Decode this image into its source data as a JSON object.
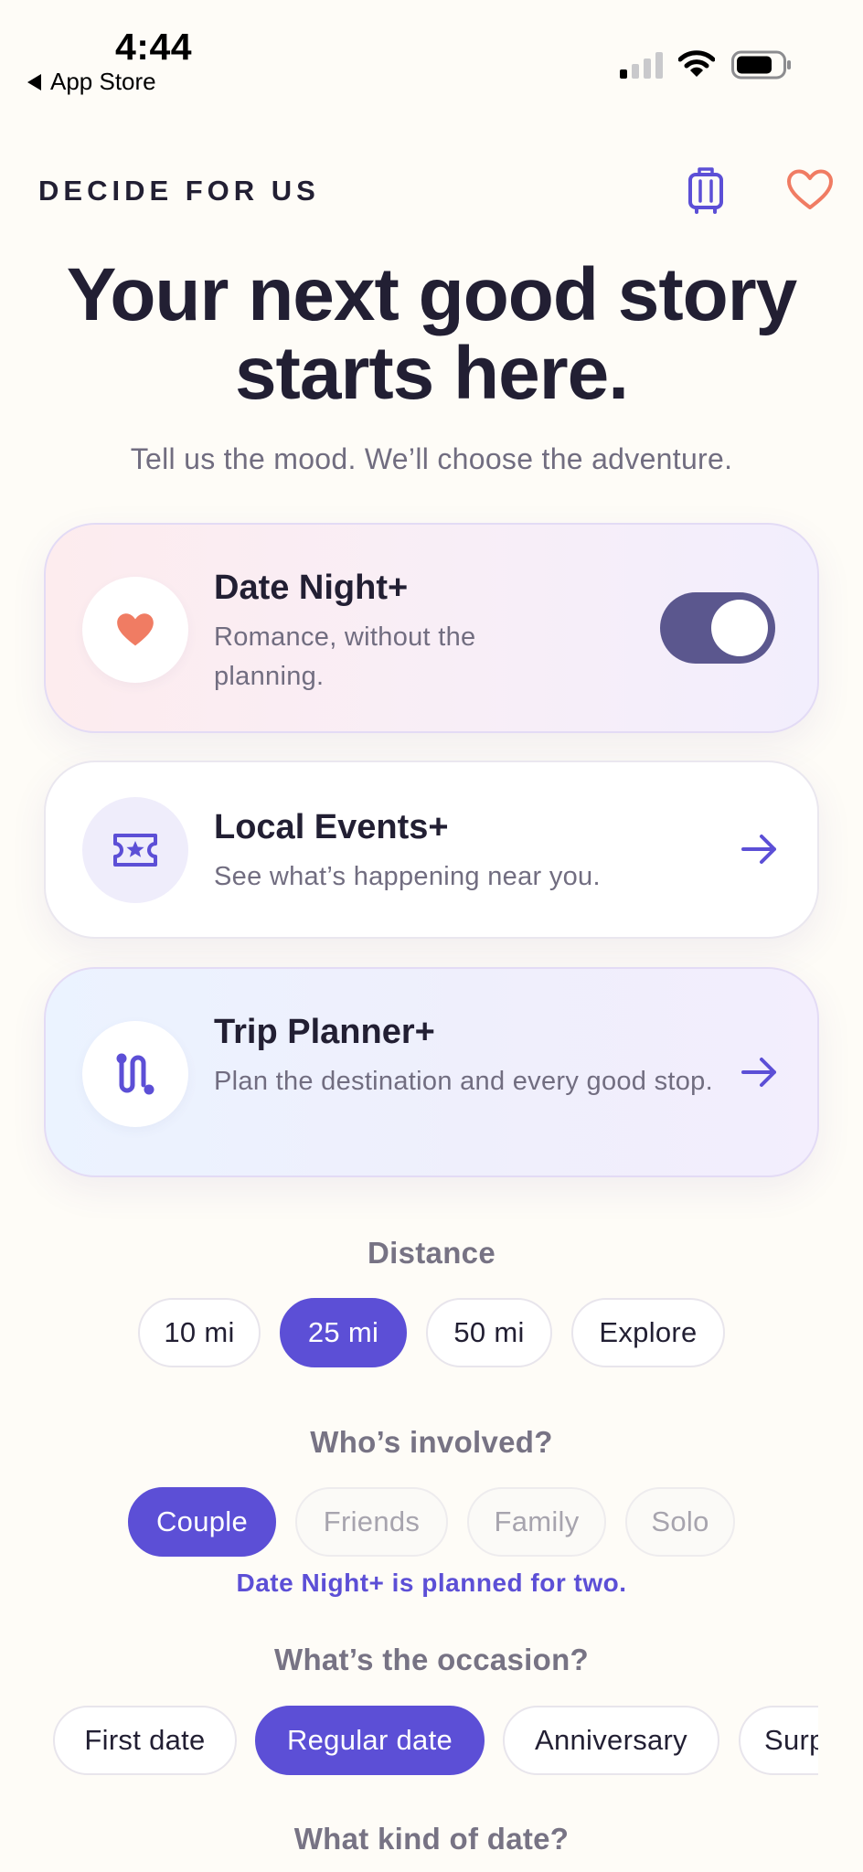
{
  "status_bar": {
    "time": "4:44",
    "back_label": "App Store",
    "icons": [
      "signal-icon",
      "wifi-icon",
      "battery-icon"
    ]
  },
  "header": {
    "brand": "DECIDE FOR US",
    "icons": [
      "luggage-icon",
      "heart-outline-icon"
    ]
  },
  "hero": {
    "title_line1": "Your next good story",
    "title_line2": "starts here.",
    "subtitle": "Tell us the mood. We’ll choose the adventure."
  },
  "modes": [
    {
      "title": "Date Night+",
      "description": "Romance, without the planning.",
      "icon": "heart-icon",
      "enabled": true
    },
    {
      "title": "Local Events+",
      "description": "See what’s happening near you.",
      "icon": "ticket-icon"
    },
    {
      "title": "Trip Planner+",
      "description": "Plan the destination and every good stop.",
      "icon": "route-icon"
    }
  ],
  "distance": {
    "title": "Distance",
    "options": [
      "10 mi",
      "25 mi",
      "50 mi",
      "Explore"
    ],
    "selected": "25 mi"
  },
  "who": {
    "title": "Who’s involved?",
    "options": [
      "Couple",
      "Friends",
      "Family",
      "Solo"
    ],
    "selected": "Couple",
    "note": "Date Night+ is planned for two."
  },
  "occasion": {
    "title": "What’s the occasion?",
    "options": [
      "First date",
      "Regular date",
      "Anniversary",
      "Surprise"
    ],
    "selected": "Regular date"
  },
  "date_kind": {
    "title": "What kind of date?"
  },
  "colors": {
    "accent": "#5C4FD6",
    "coral": "#F07C63",
    "background": "#FEFCF7",
    "text": "#221F33",
    "muted": "#716D80"
  }
}
